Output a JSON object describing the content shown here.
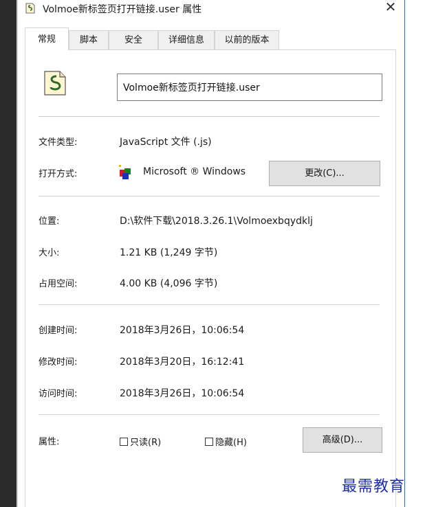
{
  "window": {
    "title": "Volmoe新标签页打开链接.user 属性",
    "close_symbol": "✕"
  },
  "tabs": [
    {
      "label": "常规",
      "active": true
    },
    {
      "label": "脚本",
      "active": false
    },
    {
      "label": "安全",
      "active": false
    },
    {
      "label": "详细信息",
      "active": false
    },
    {
      "label": "以前的版本",
      "active": false
    }
  ],
  "file": {
    "name": "Volmoe新标签页打开链接.user",
    "icon": "script-file-icon"
  },
  "type": {
    "label": "文件类型:",
    "value": "JavaScript 文件 (.js)"
  },
  "opens_with": {
    "label": "打开方式:",
    "value": "Microsoft ® Windows",
    "change_button": "更改(C)..."
  },
  "location": {
    "label": "位置:",
    "value": "D:\\软件下载\\2018.3.26.1\\Volmoexbqydklj"
  },
  "size": {
    "label": "大小:",
    "value": "1.21 KB (1,249 字节)"
  },
  "size_on_disk": {
    "label": "占用空间:",
    "value": "4.00 KB (4,096 字节)"
  },
  "created": {
    "label": "创建时间:",
    "value": "2018年3月26日，10:06:54"
  },
  "modified": {
    "label": "修改时间:",
    "value": "2018年3月20日，16:12:41"
  },
  "accessed": {
    "label": "访问时间:",
    "value": "2018年3月26日，10:06:54"
  },
  "attributes": {
    "label": "属性:",
    "readonly": "只读(R)",
    "hidden": "隐藏(H)",
    "advanced_button": "高级(D)..."
  },
  "watermark": "最需教育"
}
